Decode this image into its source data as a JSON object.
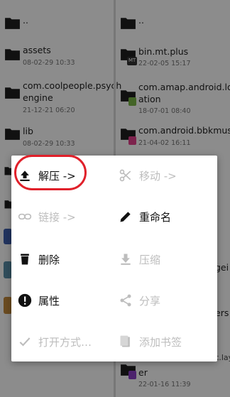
{
  "left_files": [
    {
      "name": "..",
      "date": ""
    },
    {
      "name": "assets",
      "date": "08-02-29 10:33"
    },
    {
      "name_line1": "com.coolpeople.psych",
      "name_line2": "engine",
      "date": "21-12-21 06:20"
    },
    {
      "name": "lib",
      "date": "08-02-29 10:33"
    }
  ],
  "right_files": [
    {
      "name": "..",
      "date": ""
    },
    {
      "name": "bin.mt.plus",
      "date": "22-02-05 15:17",
      "badge": "MT"
    },
    {
      "name_line1": "com.amap.android.loc",
      "name_line2": "ation",
      "date": "18-07-01 08:40"
    },
    {
      "name": "com.android.bbkmusic",
      "date": "21-04-02 16:11"
    }
  ],
  "right_bottom": {
    "partial_1": "gei",
    "partial_2": "ers",
    "partial_3": "com.android.ttmusic.layer",
    "name_line2": "er",
    "date": "22-01-16 11:39"
  },
  "menu": {
    "extract": "解压 ->",
    "move": "移动 ->",
    "link": "链接 ->",
    "rename": "重命名",
    "delete": "删除",
    "compress": "压缩",
    "properties": "属性",
    "share": "分享",
    "open_with": "打开方式…",
    "bookmark": "添加书签"
  },
  "colors": {
    "folder": "#1f1f1f",
    "highlight": "#e0202a",
    "disabled": "#bdbdbd",
    "overlay": "rgba(0,0,0,0.45)"
  }
}
